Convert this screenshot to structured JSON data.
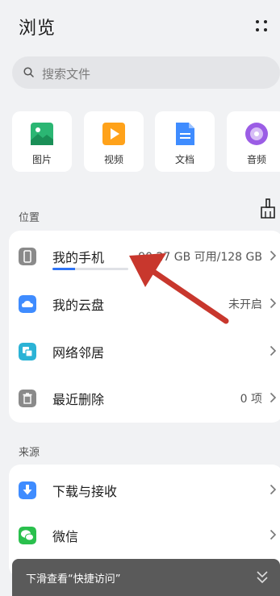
{
  "header": {
    "title": "浏览",
    "more_icon": "more-dots-icon"
  },
  "search": {
    "placeholder": "搜索文件",
    "icon": "search-icon"
  },
  "categories": [
    {
      "label": "图片",
      "icon": "image-icon",
      "color": "#2bb673"
    },
    {
      "label": "视频",
      "icon": "video-icon",
      "color": "#ffa21a"
    },
    {
      "label": "文档",
      "icon": "document-icon",
      "color": "#3f8cff"
    },
    {
      "label": "音频",
      "icon": "audio-icon",
      "color": "#9b5de5"
    }
  ],
  "locations": {
    "label": "位置",
    "clean_icon": "broom-icon",
    "items": [
      {
        "name": "我的手机",
        "info": "90.27 GB 可用/128 GB",
        "icon": "phone-icon",
        "usage_fraction": 0.3,
        "color": "#8a8a8a"
      },
      {
        "name": "我的云盘",
        "info": "未开启",
        "icon": "cloud-icon",
        "color": "#3f8cff"
      },
      {
        "name": "网络邻居",
        "info": "",
        "icon": "network-icon",
        "color": "#2bb3d6"
      },
      {
        "name": "最近删除",
        "info": "0 项",
        "icon": "trash-icon",
        "color": "#8a8a8a"
      }
    ]
  },
  "sources": {
    "label": "来源",
    "items": [
      {
        "name": "下载与接收",
        "info": "",
        "icon": "download-icon",
        "color": "#3f8cff"
      },
      {
        "name": "微信",
        "info": "",
        "icon": "wechat-icon",
        "color": "#2ac04d"
      }
    ]
  },
  "toast": {
    "text": "下滑查看“快捷访问”",
    "icon": "double-chevron-down-icon"
  },
  "annotation": {
    "color": "#c8372d"
  }
}
